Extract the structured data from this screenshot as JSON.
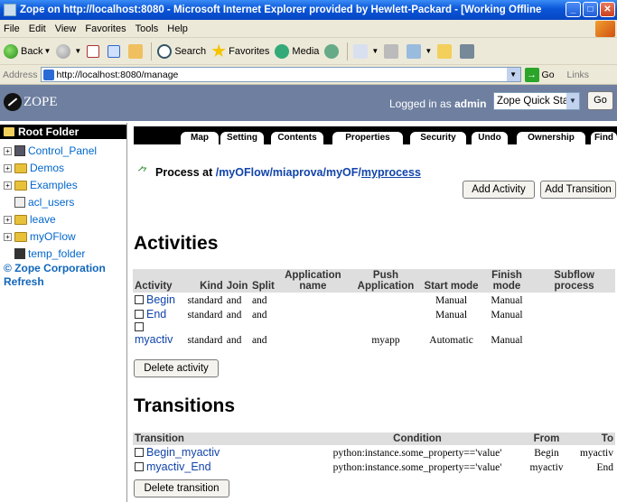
{
  "window": {
    "title": "Zope on http://localhost:8080 - Microsoft Internet Explorer provided by Hewlett-Packard - [Working Offline"
  },
  "menu": [
    "File",
    "Edit",
    "View",
    "Favorites",
    "Tools",
    "Help"
  ],
  "toolbar": {
    "back": "Back",
    "search": "Search",
    "favorites": "Favorites",
    "media": "Media"
  },
  "address": {
    "label": "Address",
    "url": "http://localhost:8080/manage",
    "go": "Go",
    "links": "Links"
  },
  "zope": {
    "logo_text": "ZOPE",
    "logged_in_prefix": "Logged in as",
    "user": "admin",
    "quick_start": "Zope Quick Start",
    "go": "Go"
  },
  "tree": {
    "root": "Root Folder",
    "items": [
      {
        "label": "Control_Panel",
        "expandable": true,
        "icon": "control-panel-icon"
      },
      {
        "label": "Demos",
        "expandable": true,
        "icon": "folder-icon"
      },
      {
        "label": "Examples",
        "expandable": true,
        "icon": "folder-icon"
      },
      {
        "label": "acl_users",
        "expandable": false,
        "icon": "acl-users-icon"
      },
      {
        "label": "leave",
        "expandable": true,
        "icon": "folder-icon"
      },
      {
        "label": "myOFlow",
        "expandable": true,
        "icon": "folder-icon"
      },
      {
        "label": "temp_folder",
        "expandable": false,
        "icon": "temp-folder-icon"
      }
    ],
    "copyright": "© Zope Corporation",
    "refresh": "Refresh"
  },
  "tabs": [
    "Map",
    "Setting",
    "Contents",
    "Properties",
    "Security",
    "Undo",
    "Ownership",
    "Find"
  ],
  "process": {
    "prefix": "Process at",
    "path": [
      "/myOFlow",
      "/miaprova",
      "/myOF/",
      "myprocess"
    ]
  },
  "buttons": {
    "add_activity": "Add Activity",
    "add_transition": "Add Transition",
    "delete_activity": "Delete activity",
    "delete_transition": "Delete transition"
  },
  "activities": {
    "title": "Activities",
    "headers": [
      "Activity",
      "Kind",
      "Join",
      "Split",
      "Application name",
      "Push Application",
      "Start mode",
      "Finish mode",
      "Subflow process"
    ],
    "rows": [
      {
        "name": "Begin",
        "kind": "standard",
        "join": "and",
        "split": "and",
        "app": "",
        "push": "",
        "start": "Manual",
        "finish": "Manual",
        "subflow": ""
      },
      {
        "name": "End",
        "kind": "standard",
        "join": "and",
        "split": "and",
        "app": "",
        "push": "",
        "start": "Manual",
        "finish": "Manual",
        "subflow": ""
      },
      {
        "name": "myactiv",
        "kind": "standard",
        "join": "and",
        "split": "and",
        "app": "",
        "push": "myapp",
        "start": "Automatic",
        "finish": "Manual",
        "subflow": ""
      }
    ]
  },
  "transitions": {
    "title": "Transitions",
    "headers": [
      "Transition",
      "Condition",
      "From",
      "To"
    ],
    "rows": [
      {
        "name": "Begin_myactiv",
        "condition": "python:instance.some_property=='value'",
        "from": "Begin",
        "to": "myactiv"
      },
      {
        "name": "myactiv_End",
        "condition": "python:instance.some_property=='value'",
        "from": "myactiv",
        "to": "End"
      }
    ]
  }
}
